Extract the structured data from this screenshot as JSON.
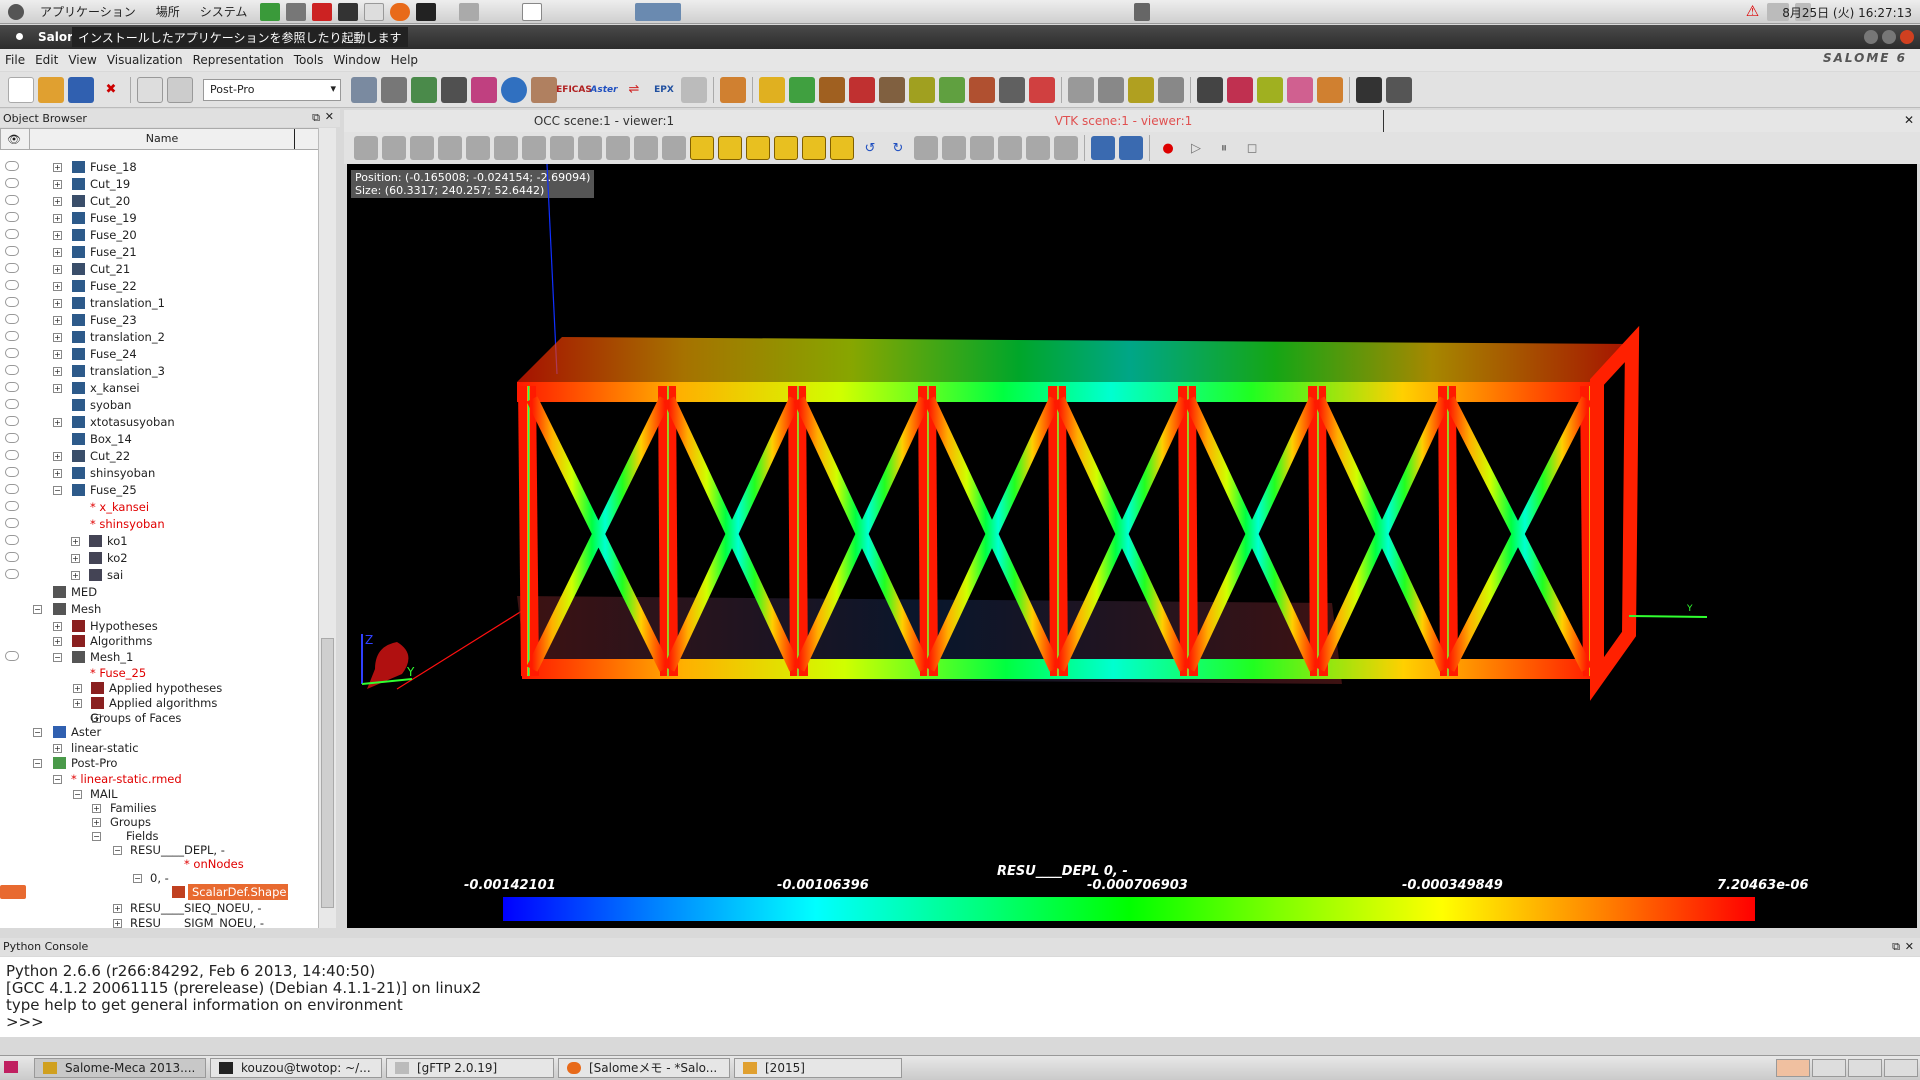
{
  "top_panel": {
    "menus": [
      "アプリケーション",
      "場所",
      "システム"
    ],
    "clock": "8月25日 (火) 16:27:13",
    "tooltip": "インストールしたアプリケーションを参照したり起動します"
  },
  "window": {
    "title": "Salor"
  },
  "menubar": {
    "items": [
      "File",
      "Edit",
      "View",
      "Visualization",
      "Representation",
      "Tools",
      "Window",
      "Help"
    ],
    "logo": "SALOME 6"
  },
  "toolbar": {
    "module_combo": "Post-Pro"
  },
  "object_browser": {
    "title": "Object Browser",
    "column_name": "Name",
    "rows": [
      {
        "label": "Fuse_18"
      },
      {
        "label": "Cut_19"
      },
      {
        "label": "Cut_20"
      },
      {
        "label": "Fuse_19"
      },
      {
        "label": "Fuse_20"
      },
      {
        "label": "Fuse_21"
      },
      {
        "label": "Cut_21"
      },
      {
        "label": "Fuse_22"
      },
      {
        "label": "translation_1"
      },
      {
        "label": "Fuse_23"
      },
      {
        "label": "translation_2"
      },
      {
        "label": "Fuse_24"
      },
      {
        "label": "translation_3"
      },
      {
        "label": "x_kansei"
      },
      {
        "label": "syoban"
      },
      {
        "label": "xtotasusyoban"
      },
      {
        "label": "Box_14"
      },
      {
        "label": "Cut_22"
      },
      {
        "label": "shinsyoban"
      },
      {
        "label": "Fuse_25"
      },
      {
        "label": "* x_kansei"
      },
      {
        "label": "* shinsyoban"
      },
      {
        "label": "ko1"
      },
      {
        "label": "ko2"
      },
      {
        "label": "sai"
      },
      {
        "label": "MED"
      },
      {
        "label": "Mesh"
      },
      {
        "label": "Hypotheses"
      },
      {
        "label": "Algorithms"
      },
      {
        "label": "Mesh_1"
      },
      {
        "label": "* Fuse_25"
      },
      {
        "label": "Applied hypotheses"
      },
      {
        "label": "Applied algorithms"
      },
      {
        "label": "Groups of Faces"
      },
      {
        "label": "Aster"
      },
      {
        "label": "linear-static"
      },
      {
        "label": "Post-Pro"
      },
      {
        "label": "* linear-static.rmed"
      },
      {
        "label": "MAIL"
      },
      {
        "label": "Families"
      },
      {
        "label": "Groups"
      },
      {
        "label": "Fields"
      },
      {
        "label": "RESU____DEPL, -"
      },
      {
        "label": "* onNodes"
      },
      {
        "label": "0, -"
      },
      {
        "label": "ScalarDef.Shape"
      },
      {
        "label": "RESU____SIEQ_NOEU, -"
      },
      {
        "label": "RESU____SIGM_NOEU, -"
      }
    ]
  },
  "viewer": {
    "tabs": [
      "OCC scene:1 - viewer:1",
      "VTK scene:1 - viewer:1"
    ],
    "position_text": "Position: (-0.165008; -0.024154; -2.69094)",
    "size_text": "Size: (60.3317; 240.257; 52.6442)",
    "scalar_bar": {
      "title": "RESU____DEPL 0, -",
      "ticks": [
        "-0.00142101",
        "-0.00106396",
        "-0.000706903",
        "-0.000349849",
        "7.20463e-06"
      ]
    },
    "axis_labels": {
      "z": "Z",
      "y": "Y"
    }
  },
  "python_console": {
    "title": "Python Console",
    "lines": [
      "Python 2.6.6 (r266:84292, Feb  6 2013, 14:40:50)",
      "[GCC 4.1.2 20061115 (prerelease) (Debian 4.1.1-21)] on linux2",
      "type help to get general information on environment",
      ">>>"
    ]
  },
  "taskbar": {
    "tasks": [
      "Salome-Meca 2013....",
      "kouzou@twotop: ~/...",
      "[gFTP 2.0.19]",
      "[Salomeメモ - *Salo...",
      "[2015]"
    ]
  }
}
